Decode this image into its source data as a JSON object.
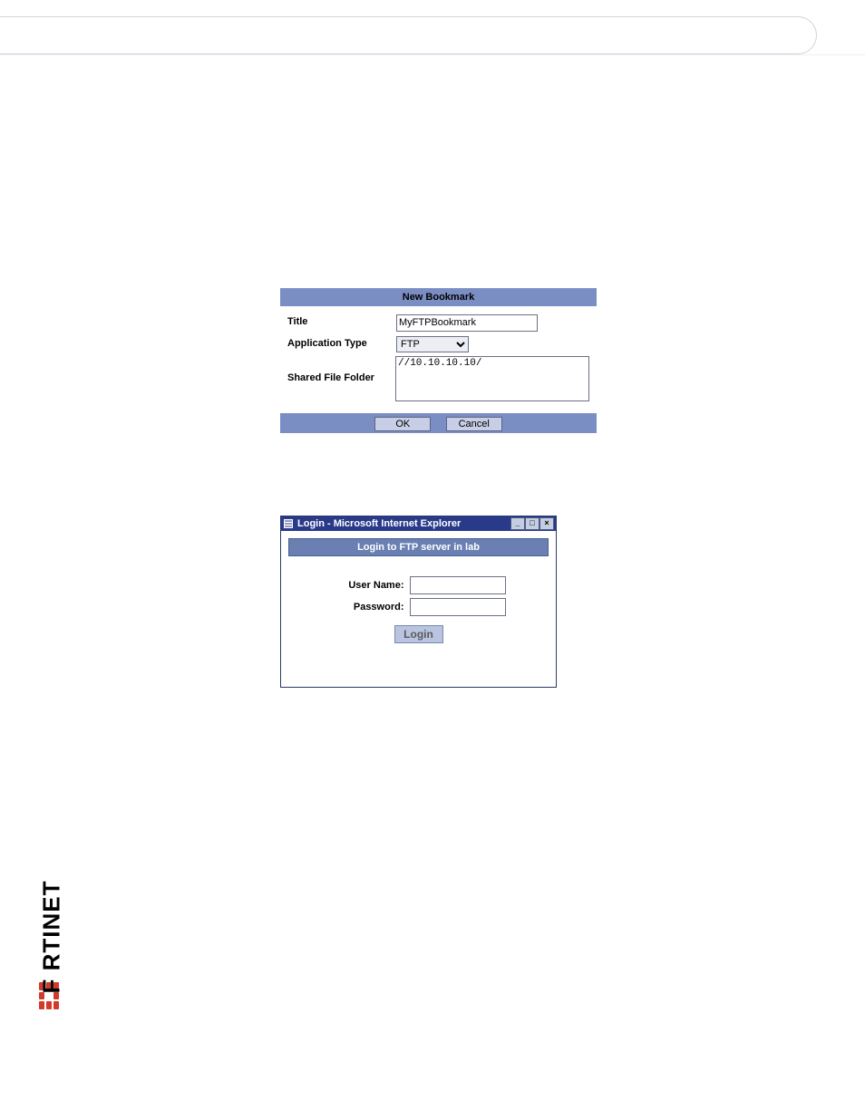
{
  "bookmark": {
    "header": "New Bookmark",
    "title_label": "Title",
    "title_value": "MyFTPBookmark",
    "apptype_label": "Application Type",
    "apptype_value": "FTP",
    "shared_label": "Shared File Folder",
    "shared_value": "//10.10.10.10/",
    "ok_label": "OK",
    "cancel_label": "Cancel"
  },
  "iewin": {
    "title": "Login - Microsoft Internet Explorer",
    "banner": "Login to FTP server in lab",
    "username_label": "User Name:",
    "password_label": "Password:",
    "login_label": "Login"
  },
  "brand": {
    "name": "F   RTINET"
  }
}
